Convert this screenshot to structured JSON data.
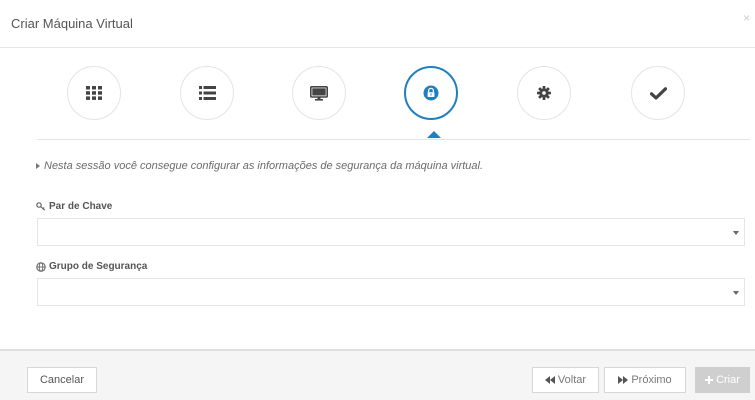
{
  "dialog": {
    "title": "Criar Máquina Virtual",
    "close_label": "×"
  },
  "steps": [
    {
      "icon": "grid-icon",
      "active": false
    },
    {
      "icon": "list-icon",
      "active": false
    },
    {
      "icon": "monitor-icon",
      "active": false
    },
    {
      "icon": "lock-icon",
      "active": true
    },
    {
      "icon": "gear-icon",
      "active": false
    },
    {
      "icon": "checkmark-icon",
      "active": false
    }
  ],
  "content": {
    "info_text": "Nesta sessão você consegue configurar as informações de segurança da máquina virtual.",
    "key_pair": {
      "label": "Par de Chave",
      "value": "",
      "icon": "key-icon"
    },
    "security_group": {
      "label": "Grupo de Segurança",
      "value": "",
      "icon": "globe-icon"
    }
  },
  "footer": {
    "cancel_label": "Cancelar",
    "back_label": "Voltar",
    "next_label": "Próximo",
    "create_label": "Criar"
  },
  "colors": {
    "accent": "#1f7fbf",
    "icon": "#444444",
    "disabled_button": "#cfcfcf"
  }
}
